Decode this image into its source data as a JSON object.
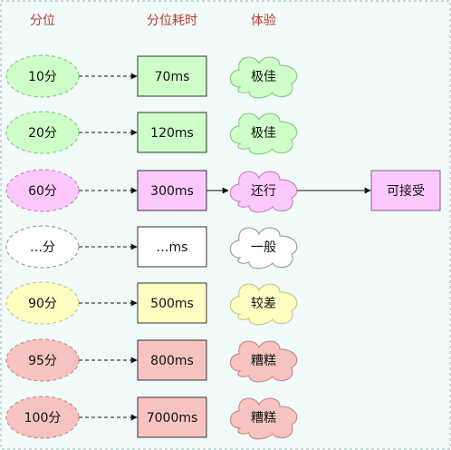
{
  "headers": {
    "percentile": "分位",
    "latency": "分位耗时",
    "experience": "体验"
  },
  "colors": {
    "header_text": "#c0392b",
    "frame": "#8fb8b0",
    "background": "#f1fbfa"
  },
  "rows": [
    {
      "percentile": "10分",
      "latency": "70ms",
      "experience": "极佳",
      "fill": "#cfffc8",
      "stroke": "#92c98b",
      "dashed_stroke": true
    },
    {
      "percentile": "20分",
      "latency": "120ms",
      "experience": "极佳",
      "fill": "#cfffc8",
      "stroke": "#92c98b",
      "dashed_stroke": true
    },
    {
      "percentile": "60分",
      "latency": "300ms",
      "experience": "还行",
      "fill": "#fdc8fd",
      "stroke": "#c58ac5",
      "dashed_stroke": true
    },
    {
      "percentile": "…分",
      "latency": "…ms",
      "experience": "一般",
      "fill": "#ffffff",
      "stroke": "#9e9e9e",
      "dashed_stroke": true
    },
    {
      "percentile": "90分",
      "latency": "500ms",
      "experience": "较差",
      "fill": "#ffffc4",
      "stroke": "#c9c98c",
      "dashed_stroke": true
    },
    {
      "percentile": "95分",
      "latency": "800ms",
      "experience": "糟糕",
      "fill": "#f7c3c0",
      "stroke": "#c98e8a",
      "dashed_stroke": true
    },
    {
      "percentile": "100分",
      "latency": "7000ms",
      "experience": "糟糕",
      "fill": "#f7c3c0",
      "stroke": "#c98e8a",
      "dashed_stroke": true
    }
  ],
  "acceptable": {
    "label": "可接受",
    "fill": "#fdc8fd",
    "stroke": "#8a5a8a",
    "from_row": 2
  }
}
